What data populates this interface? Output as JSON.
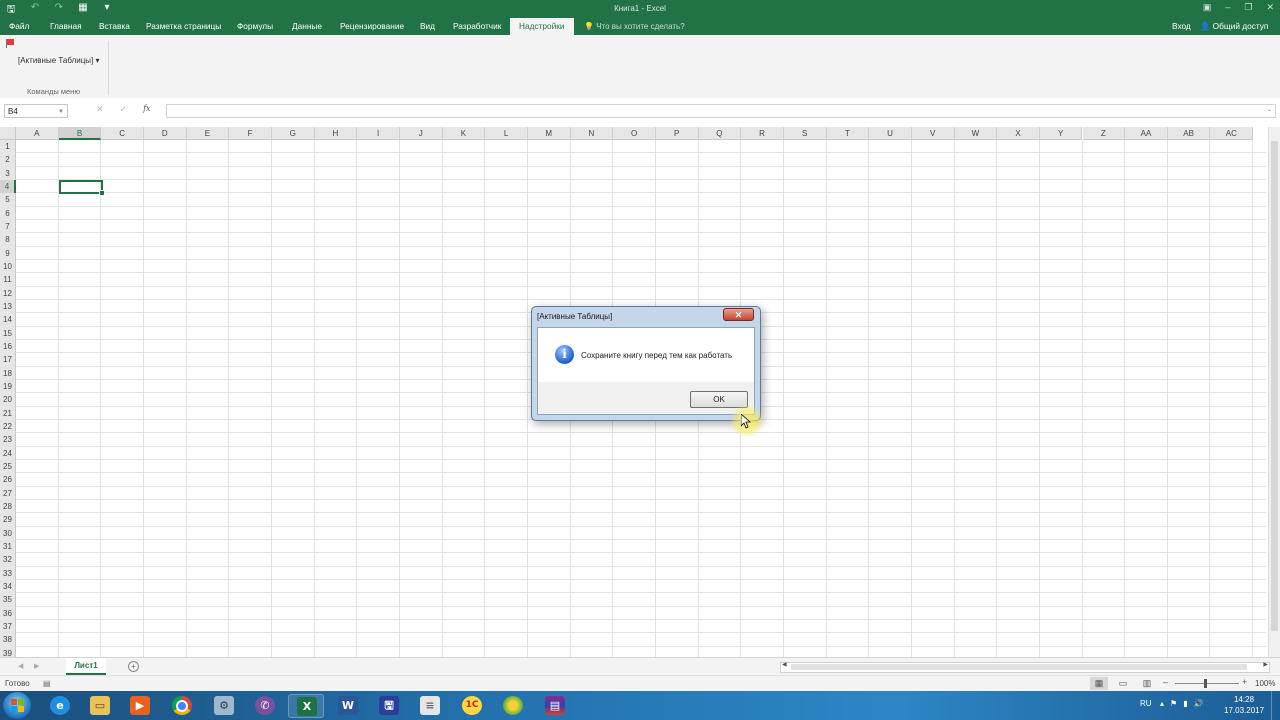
{
  "window": {
    "title": "Книга1 - Excel",
    "quick_access": [
      "save-icon",
      "undo-icon",
      "redo-icon",
      "customize-icon"
    ],
    "controls": [
      "ribbon-display-icon",
      "minimize-icon",
      "restore-icon",
      "close-icon"
    ]
  },
  "ribbon_tabs": [
    {
      "label": "Файл"
    },
    {
      "label": "Главная"
    },
    {
      "label": "Вставка"
    },
    {
      "label": "Разметка страницы"
    },
    {
      "label": "Формулы"
    },
    {
      "label": "Данные"
    },
    {
      "label": "Рецензирование"
    },
    {
      "label": "Вид"
    },
    {
      "label": "Разработчик"
    },
    {
      "label": "Надстройки",
      "active": true
    }
  ],
  "tell_me": "Что вы хотите сделать?",
  "signin": "Вход",
  "share": "Общий доступ",
  "ribbon": {
    "addin_button": "[Активные Таблицы]",
    "group_label": "Команды меню"
  },
  "formula_bar": {
    "name_box": "B4",
    "cancel": "✕",
    "enter": "✓",
    "fx": "fx",
    "value": ""
  },
  "grid": {
    "columns": [
      "A",
      "B",
      "C",
      "D",
      "E",
      "F",
      "G",
      "H",
      "I",
      "J",
      "K",
      "L",
      "M",
      "N",
      "O",
      "P",
      "Q",
      "R",
      "S",
      "T",
      "U",
      "V",
      "W",
      "X",
      "Y",
      "Z",
      "AA",
      "AB",
      "AC"
    ],
    "rows": [
      "1",
      "2",
      "3",
      "4",
      "5",
      "6",
      "7",
      "8",
      "9",
      "10",
      "11",
      "12",
      "13",
      "14",
      "15",
      "16",
      "17",
      "18",
      "19",
      "20",
      "21",
      "22",
      "23",
      "24",
      "25",
      "26",
      "27",
      "28",
      "29",
      "30",
      "31",
      "32",
      "33",
      "34",
      "35",
      "36",
      "37",
      "38",
      "39"
    ],
    "selected_column": "B",
    "selected_row": "4"
  },
  "sheets": [
    {
      "label": "Лист1",
      "active": true
    }
  ],
  "status": {
    "ready": "Готово",
    "zoom": "100%"
  },
  "dialog": {
    "title": "[Активные Таблицы]",
    "message": "Сохраните книгу перед тем как работать",
    "ok": "OK",
    "close": "✕",
    "icon": "info-icon"
  },
  "taskbar": {
    "apps": [
      "internet-explorer-icon",
      "file-explorer-icon",
      "media-player-icon",
      "chrome-icon",
      "network-icon",
      "viber-icon",
      "excel-icon",
      "word-icon",
      "save-app-icon",
      "document-icon",
      "1c-icon",
      "green-app-icon",
      "winrar-icon"
    ],
    "language": "RU",
    "time": "14:28",
    "date": "17.03.2017",
    "colors": {
      "excel_green": "#217346",
      "accent_blue": "#2373b0"
    }
  }
}
